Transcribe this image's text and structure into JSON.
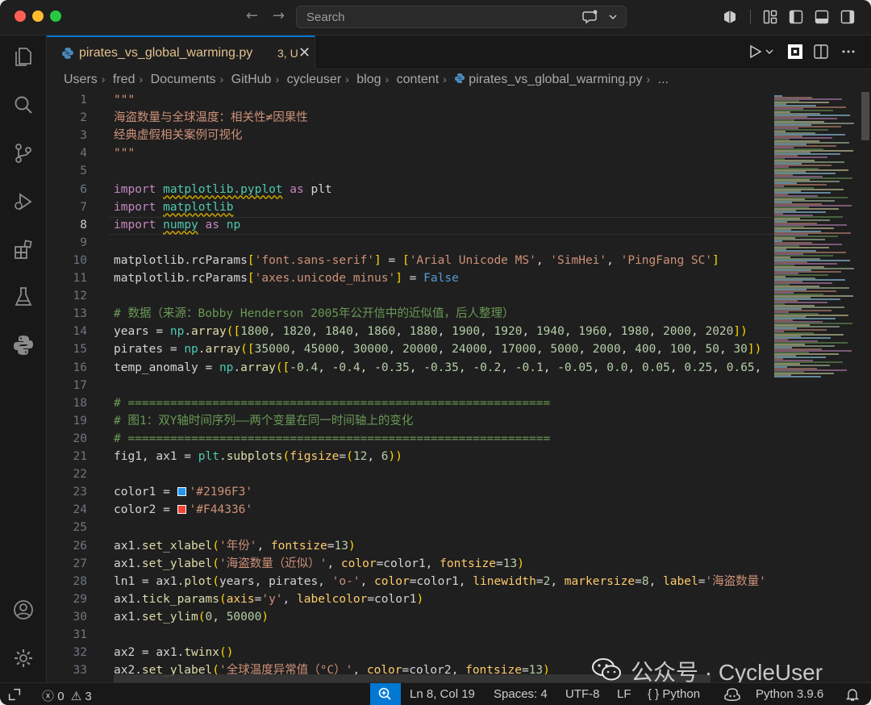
{
  "titlebar": {
    "search_placeholder": "Search"
  },
  "tab": {
    "filename": "pirates_vs_global_warming.py",
    "badge": "3, U",
    "close_glyph": "✕"
  },
  "breadcrumb": [
    "Users",
    "fred",
    "Documents",
    "GitHub",
    "cycleuser",
    "blog",
    "content",
    "pirates_vs_global_warming.py",
    "..."
  ],
  "editor": {
    "current_line": 8,
    "line_numbers": [
      "1",
      "2",
      "3",
      "4",
      "5",
      "6",
      "7",
      "8",
      "9",
      "10",
      "11",
      "12",
      "13",
      "14",
      "15",
      "16",
      "17",
      "18",
      "19",
      "20",
      "21",
      "22",
      "23",
      "24",
      "25",
      "26",
      "27",
      "28",
      "29",
      "30",
      "31",
      "32",
      "33"
    ],
    "lines": [
      "\"\"\"",
      "海盗数量与全球温度：相关性≠因果性",
      "经典虚假相关案例可视化",
      "\"\"\"",
      "",
      "import matplotlib.pyplot as plt",
      "import matplotlib",
      "import numpy as np",
      "",
      "matplotlib.rcParams['font.sans-serif'] = ['Arial Unicode MS', 'SimHei', 'PingFang SC']",
      "matplotlib.rcParams['axes.unicode_minus'] = False",
      "",
      "# 数据（来源：Bobby Henderson 2005年公开信中的近似值，后人整理）",
      "years = np.array([1800, 1820, 1840, 1860, 1880, 1900, 1920, 1940, 1960, 1980, 2000, 2020])",
      "pirates = np.array([35000, 45000, 30000, 20000, 24000, 17000, 5000, 2000, 400, 100, 50, 30])",
      "temp_anomaly = np.array([-0.4, -0.4, -0.35, -0.35, -0.2, -0.1, -0.05, 0.0, 0.05, 0.25, 0.65,",
      "",
      "# ============================================================",
      "# 图1：双Y轴时间序列——两个变量在同一时间轴上的变化",
      "# ============================================================",
      "fig1, ax1 = plt.subplots(figsize=(12, 6))",
      "",
      "color1 = '#2196F3'",
      "color2 = '#F44336'",
      "",
      "ax1.set_xlabel('年份', fontsize=13)",
      "ax1.set_ylabel('海盗数量（近似）', color=color1, fontsize=13)",
      "ln1 = ax1.plot(years, pirates, 'o-', color=color1, linewidth=2, markersize=8, label='海盗数量'",
      "ax1.tick_params(axis='y', labelcolor=color1)",
      "ax1.set_ylim(0, 50000)",
      "",
      "ax2 = ax1.twinx()",
      "ax2.set_ylabel('全球温度异常值（°C）', color=color2, fontsize=13)"
    ],
    "swatch_colors": [
      "#2196F3",
      "#F44336"
    ]
  },
  "watermark": "公众号 · CycleUser",
  "statusbar": {
    "errors": "0",
    "warnings": "3",
    "position": "Ln 8, Col 19",
    "spaces": "Spaces: 4",
    "encoding": "UTF-8",
    "eol": "LF",
    "language": "Python",
    "interpreter": "Python 3.9.6"
  },
  "colors": {
    "accent": "#0078d4",
    "editor_bg": "#1f1f1f",
    "modified_tab": "#e2c08d"
  }
}
